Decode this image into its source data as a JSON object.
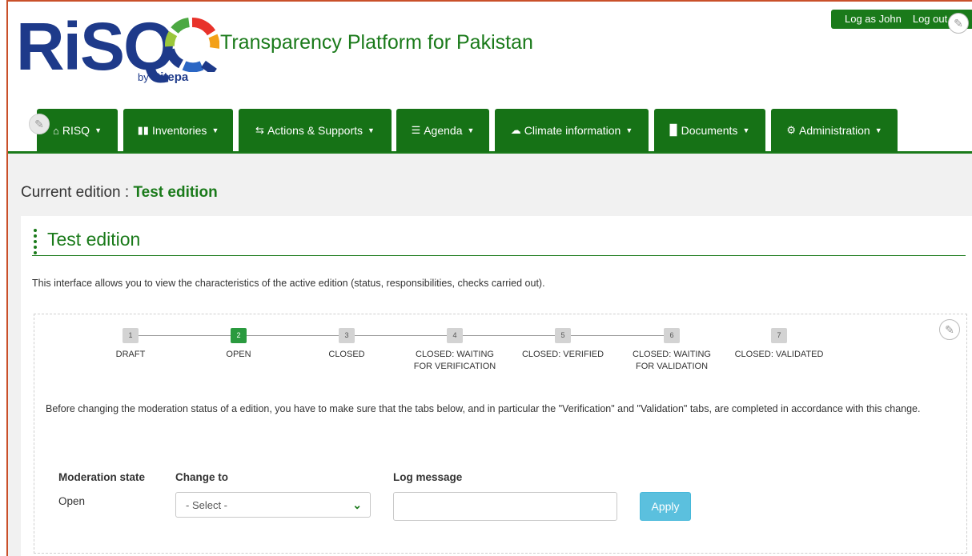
{
  "header": {
    "logo_text": "RiSQ",
    "logo_by": "by",
    "logo_brand": "Citepa",
    "site_title": "Transparency Platform for Pakistan",
    "login_label": "Log as John",
    "logout_label": "Log out"
  },
  "nav": {
    "items": [
      {
        "label": "RISQ",
        "icon": "home-icon"
      },
      {
        "label": "Inventories",
        "icon": "bar-chart-icon"
      },
      {
        "label": "Actions & Supports",
        "icon": "exchange-icon"
      },
      {
        "label": "Agenda",
        "icon": "list-icon"
      },
      {
        "label": "Climate information",
        "icon": "cloud-icon"
      },
      {
        "label": "Documents",
        "icon": "book-icon"
      },
      {
        "label": "Administration",
        "icon": "gear-icon"
      }
    ]
  },
  "page": {
    "current_edition_label": "Current edition :",
    "current_edition_value": "Test edition",
    "panel_title": "Test edition",
    "intro": "This interface allows you to view the characteristics of the active edition (status, responsibilities, checks carried out)."
  },
  "stepper": {
    "active_step": 2,
    "steps": [
      {
        "num": "1",
        "label": "DRAFT"
      },
      {
        "num": "2",
        "label": "OPEN"
      },
      {
        "num": "3",
        "label": "CLOSED"
      },
      {
        "num": "4",
        "label": "CLOSED: WAITING FOR VERIFICATION"
      },
      {
        "num": "5",
        "label": "CLOSED: VERIFIED"
      },
      {
        "num": "6",
        "label": "CLOSED: WAITING FOR VALIDATION"
      },
      {
        "num": "7",
        "label": "CLOSED: VALIDATED"
      }
    ]
  },
  "moderation": {
    "warning": "Before changing the moderation status of a edition, you have to make sure that the tabs below, and in particular the \"Verification\" and \"Validation\" tabs, are completed in accordance with this change.",
    "state_label": "Moderation state",
    "state_value": "Open",
    "change_label": "Change to",
    "select_value": "- Select -",
    "log_label": "Log message",
    "log_value": "",
    "apply_label": "Apply"
  },
  "colors": {
    "brand_green": "#1a7a1a",
    "nav_green": "#167216",
    "logo_blue": "#1e3a8a",
    "apply_blue": "#5bc0de",
    "active_step": "#2a9a3f"
  }
}
